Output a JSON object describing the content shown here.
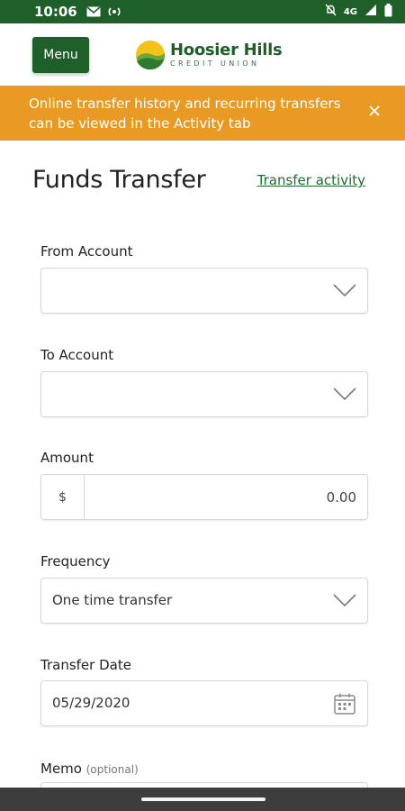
{
  "status_bar": {
    "time": "10:06",
    "icons": [
      "mail-icon",
      "hotspot-icon",
      "mute-icon",
      "network-4g-icon",
      "signal-icon",
      "battery-icon"
    ],
    "network": "4G"
  },
  "header": {
    "menu_label": "Menu",
    "logo_name": "Hoosier Hills",
    "logo_sub": "CREDIT UNION"
  },
  "banner": {
    "message": "Online transfer history and recurring transfers can be viewed in the Activity tab",
    "close_icon": "close-icon"
  },
  "page": {
    "title": "Funds Transfer",
    "activity_link": "Transfer activity"
  },
  "form": {
    "from_label": "From Account",
    "from_value": "",
    "to_label": "To Account",
    "to_value": "",
    "amount_label": "Amount",
    "amount_prefix": "$",
    "amount_value": "0.00",
    "frequency_label": "Frequency",
    "frequency_value": "One time transfer",
    "date_label": "Transfer Date",
    "date_value": "05/29/2020",
    "memo_label": "Memo",
    "memo_optional": "(optional)"
  },
  "colors": {
    "brand_green": "#1f5f2a",
    "banner_orange": "#e99a24",
    "link_green": "#1f6b32"
  }
}
